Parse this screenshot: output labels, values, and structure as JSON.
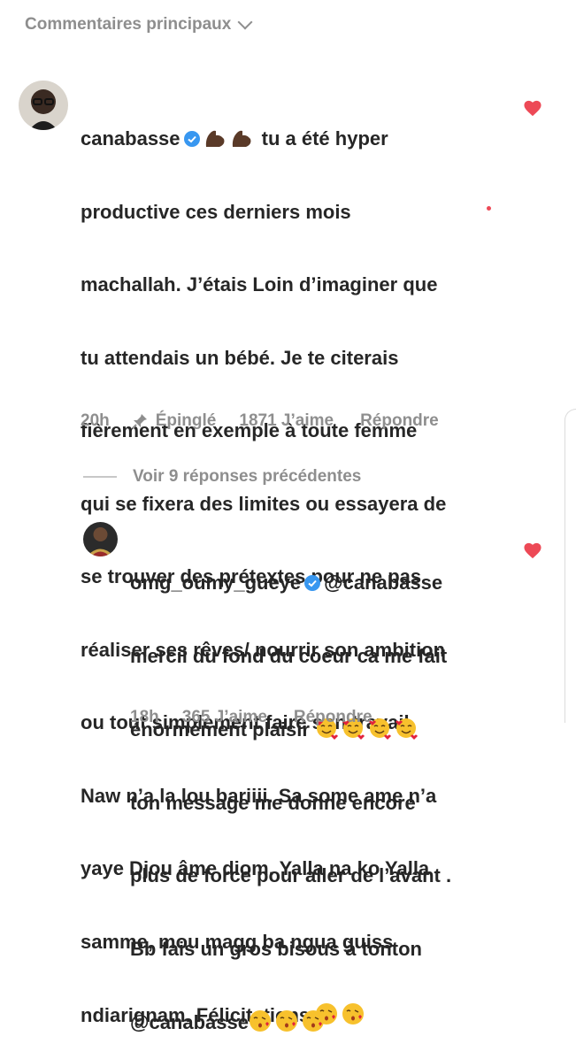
{
  "header": {
    "sort_label": "Commentaires principaux"
  },
  "comment1": {
    "username": "canabasse",
    "text_lines": [
      " tu a été hyper",
      "productive ces derniers mois",
      "machallah. J’étais Loin d’imaginer que",
      "tu attendais un bébé. Je te citerais",
      "fièrement en exemple à toute femme",
      "qui se fixera des limites ou essayera de",
      "se trouver des prétextes pour ne pas",
      "réaliser ses rêves/ nourrir son ambition",
      "ou tout simplement faire son travail.",
      "Naw n’a la lou bariiii. Sa some ame n’a",
      "yaye Djou âme diom. Yalla na ko Yalla",
      "samme, mou magg ba ngua guiss",
      "ndiarignam. Félicitations"
    ],
    "time": "20h",
    "pinned_label": "Épinglé",
    "likes": "1871 J’aime",
    "reply_label": "Répondre"
  },
  "view_replies": "Voir 9 réponses précédentes",
  "reply1": {
    "username": "omg_oumy_gueye",
    "mention": "@canabasse",
    "text_lines": [
      "mercii du fond du coeur ca me fait",
      "énormément plaisir",
      "ton message me donne encore",
      "plus de force pour aller de l’avant .",
      "Bb fais un gros bisous à tonton"
    ],
    "mention2": "@canabasse",
    "time": "18h",
    "likes": "365 J’aime",
    "reply_label": "Répondre"
  },
  "icons": {
    "heart_color": "#ed4956",
    "verified_color": "#3897f0",
    "muscle_emoji": "flexed-biceps",
    "kiss_emoji": "face-blowing-kiss",
    "love_emoji": "smiling-face-with-hearts"
  }
}
